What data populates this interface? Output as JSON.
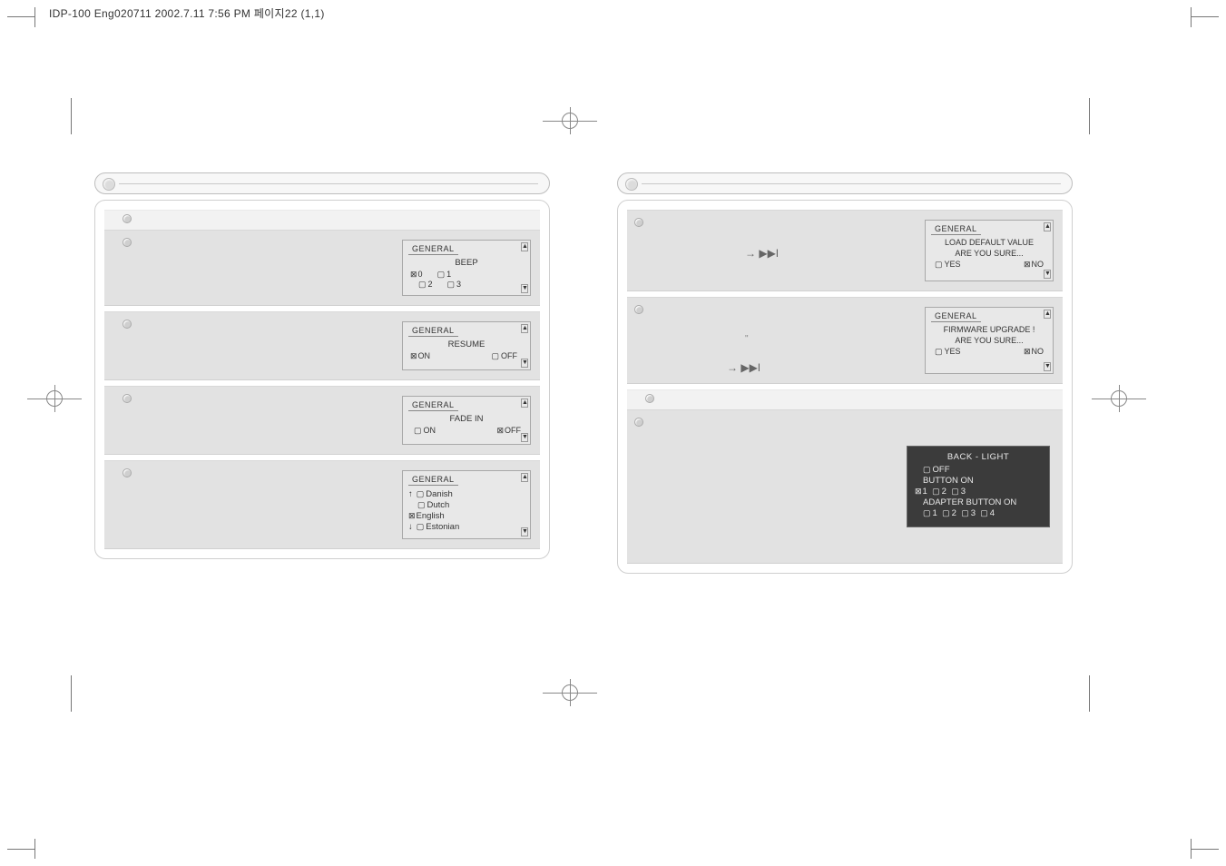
{
  "print_header": "IDP-100 Eng020711  2002.7.11 7:56 PM  페이지22 (1,1)",
  "screens": {
    "beep": {
      "tab": "GENERAL",
      "title": "BEEP",
      "opts": [
        "0",
        "1",
        "2",
        "3"
      ],
      "selected": "0"
    },
    "resume": {
      "tab": "GENERAL",
      "title": "RESUME",
      "opts": [
        "ON",
        "OFF"
      ],
      "selected": "ON"
    },
    "fadein": {
      "tab": "GENERAL",
      "title": "FADE IN",
      "opts": [
        "ON",
        "OFF"
      ],
      "selected": "OFF"
    },
    "language": {
      "tab": "GENERAL",
      "items": [
        "Danish",
        "Dutch",
        "English",
        "Estonian"
      ],
      "selected": "English"
    },
    "load_default": {
      "tab": "GENERAL",
      "line1": "LOAD DEFAULT VALUE",
      "line2": "ARE YOU SURE...",
      "yes": "YES",
      "no": "NO",
      "selected": "NO"
    },
    "firmware": {
      "tab": "GENERAL",
      "line1": "FIRMWARE UPGRADE !",
      "line2": "ARE YOU SURE...",
      "yes": "YES",
      "no": "NO",
      "selected": "NO"
    },
    "backlight": {
      "title": "BACK - LIGHT",
      "row_off": "OFF",
      "row_button_on": "BUTTON ON",
      "button_on_opts": [
        "1",
        "2",
        "3"
      ],
      "button_on_selected": "1",
      "row_adapter": "ADAPTER BUTTON ON",
      "adapter_opts": [
        "1",
        "2",
        "3",
        "4"
      ]
    }
  },
  "glyphs": {
    "arrow_next": "→ ▶▶I",
    "quote": "\""
  }
}
